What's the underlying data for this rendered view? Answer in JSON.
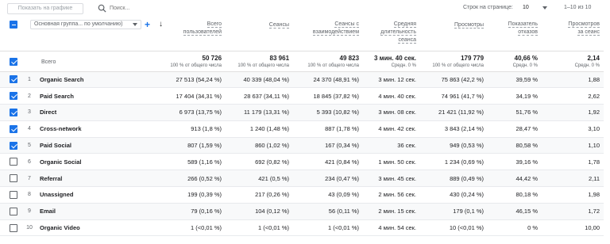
{
  "toolbar": {
    "chart_button": "Показать на графике",
    "search_placeholder": "Поиск...",
    "rows_label": "Строк на странице:",
    "rows_value": "10",
    "range": "1–10 из 10"
  },
  "dimension_select": "Основная группа... по умолчанию)",
  "headers": {
    "users": [
      "Всего",
      "пользователей"
    ],
    "sessions": [
      "Сеансы"
    ],
    "engaged": [
      "Сеансы с",
      "взаимодействием"
    ],
    "duration": [
      "Средняя",
      "длительность",
      "сеанса"
    ],
    "views": [
      "Просмотры"
    ],
    "bounce": [
      "Показатель",
      "отказов"
    ],
    "views_per_session": [
      "Просмотров",
      "за сеанс"
    ]
  },
  "totals": {
    "label": "Всего",
    "users": "50 726",
    "users_sub": "100 % от общего числа",
    "sessions": "83 961",
    "sessions_sub": "100 % от общего числа",
    "engaged": "49 823",
    "engaged_sub": "100 % от общего числа",
    "duration": "3 мин. 40 сек.",
    "duration_sub": "Средн. 0 %",
    "views": "179 779",
    "views_sub": "100 % от общего числа",
    "bounce": "40,66 %",
    "bounce_sub": "Средн. 0 %",
    "vps": "2,14",
    "vps_sub": "Средн. 0 %"
  },
  "rows": [
    {
      "idx": "1",
      "name": "Organic Search",
      "checked": true,
      "users": "27 513 (54,24 %)",
      "sessions": "40 339 (48,04 %)",
      "engaged": "24 370 (48,91 %)",
      "duration": "3 мин. 12 сек.",
      "views": "75 863 (42,2 %)",
      "bounce": "39,59 %",
      "vps": "1,88"
    },
    {
      "idx": "2",
      "name": "Paid Search",
      "checked": true,
      "users": "17 404 (34,31 %)",
      "sessions": "28 637 (34,11 %)",
      "engaged": "18 845 (37,82 %)",
      "duration": "4 мин. 40 сек.",
      "views": "74 961 (41,7 %)",
      "bounce": "34,19 %",
      "vps": "2,62"
    },
    {
      "idx": "3",
      "name": "Direct",
      "checked": true,
      "users": "6 973 (13,75 %)",
      "sessions": "11 179 (13,31 %)",
      "engaged": "5 393 (10,82 %)",
      "duration": "3 мин. 08 сек.",
      "views": "21 421 (11,92 %)",
      "bounce": "51,76 %",
      "vps": "1,92"
    },
    {
      "idx": "4",
      "name": "Cross-network",
      "checked": true,
      "users": "913 (1,8 %)",
      "sessions": "1 240 (1,48 %)",
      "engaged": "887 (1,78 %)",
      "duration": "4 мин. 42 сек.",
      "views": "3 843 (2,14 %)",
      "bounce": "28,47 %",
      "vps": "3,10"
    },
    {
      "idx": "5",
      "name": "Paid Social",
      "checked": true,
      "users": "807 (1,59 %)",
      "sessions": "860 (1,02 %)",
      "engaged": "167 (0,34 %)",
      "duration": "36 сек.",
      "views": "949 (0,53 %)",
      "bounce": "80,58 %",
      "vps": "1,10"
    },
    {
      "idx": "6",
      "name": "Organic Social",
      "checked": false,
      "users": "589 (1,16 %)",
      "sessions": "692 (0,82 %)",
      "engaged": "421 (0,84 %)",
      "duration": "1 мин. 50 сек.",
      "views": "1 234 (0,69 %)",
      "bounce": "39,16 %",
      "vps": "1,78"
    },
    {
      "idx": "7",
      "name": "Referral",
      "checked": false,
      "users": "266 (0,52 %)",
      "sessions": "421 (0,5 %)",
      "engaged": "234 (0,47 %)",
      "duration": "3 мин. 45 сек.",
      "views": "889 (0,49 %)",
      "bounce": "44,42 %",
      "vps": "2,11"
    },
    {
      "idx": "8",
      "name": "Unassigned",
      "checked": false,
      "users": "199 (0,39 %)",
      "sessions": "217 (0,26 %)",
      "engaged": "43 (0,09 %)",
      "duration": "2 мин. 56 сек.",
      "views": "430 (0,24 %)",
      "bounce": "80,18 %",
      "vps": "1,98"
    },
    {
      "idx": "9",
      "name": "Email",
      "checked": false,
      "users": "79 (0,16 %)",
      "sessions": "104 (0,12 %)",
      "engaged": "56 (0,11 %)",
      "duration": "2 мин. 15 сек.",
      "views": "179 (0,1 %)",
      "bounce": "46,15 %",
      "vps": "1,72"
    },
    {
      "idx": "10",
      "name": "Organic Video",
      "checked": false,
      "users": "1 (<0,01 %)",
      "sessions": "1 (<0,01 %)",
      "engaged": "1 (<0,01 %)",
      "duration": "4 мин. 54 сек.",
      "views": "10 (<0,01 %)",
      "bounce": "0 %",
      "vps": "10,00"
    }
  ],
  "colors": {
    "accent": "#1a73e8",
    "row_alt": "#f8f9fa",
    "border": "#e0e0e0"
  }
}
